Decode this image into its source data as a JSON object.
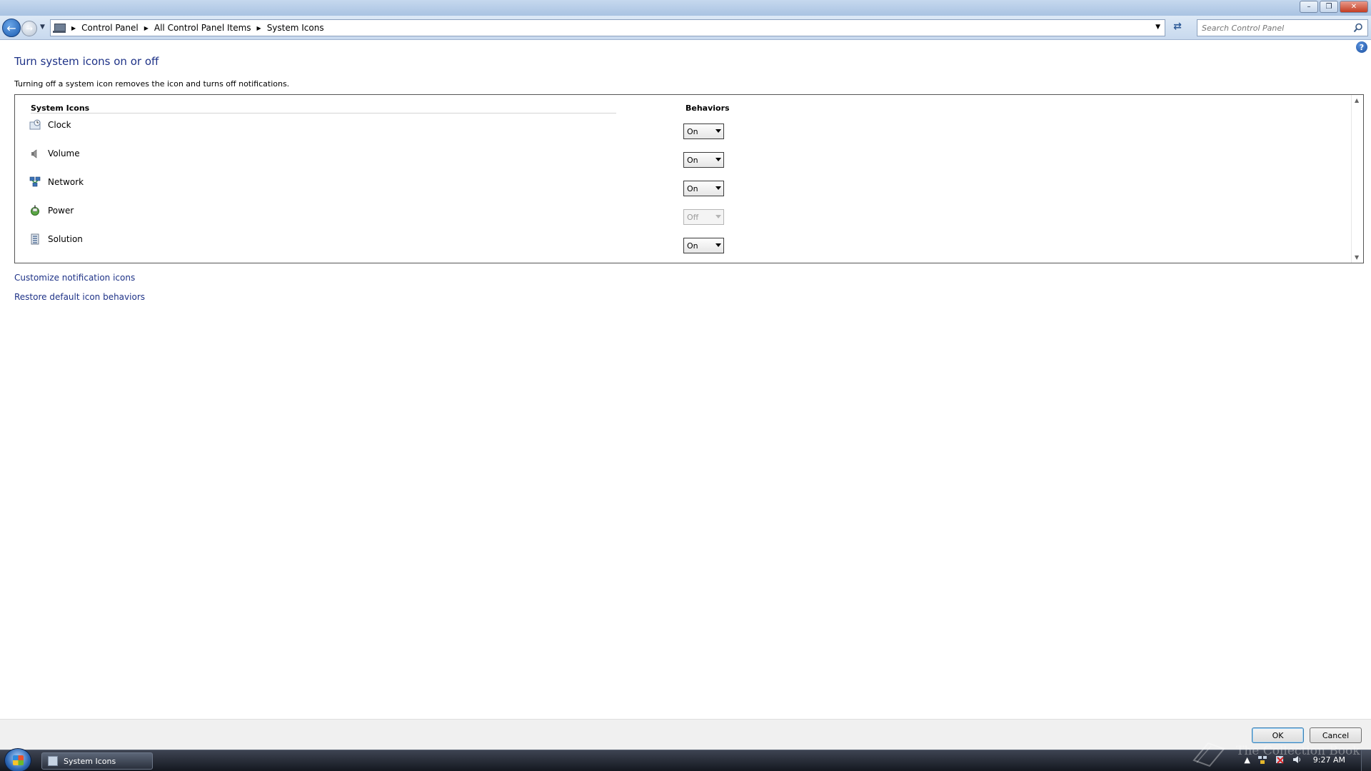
{
  "breadcrumbs": [
    "Control Panel",
    "All Control Panel Items",
    "System Icons"
  ],
  "search": {
    "placeholder": "Search Control Panel"
  },
  "page": {
    "title": "Turn system icons on or off",
    "description": "Turning off a system icon removes the icon and turns off notifications."
  },
  "table": {
    "col_icons": "System Icons",
    "col_behaviors": "Behaviors",
    "rows": [
      {
        "label": "Clock",
        "value": "On",
        "enabled": true,
        "icon": "clock-icon"
      },
      {
        "label": "Volume",
        "value": "On",
        "enabled": true,
        "icon": "volume-icon"
      },
      {
        "label": "Network",
        "value": "On",
        "enabled": true,
        "icon": "network-icon"
      },
      {
        "label": "Power",
        "value": "Off",
        "enabled": false,
        "icon": "power-icon"
      },
      {
        "label": "Solution",
        "value": "On",
        "enabled": true,
        "icon": "action-center-icon"
      }
    ]
  },
  "links": {
    "customize": "Customize notification icons",
    "restore": "Restore default icon behaviors"
  },
  "buttons": {
    "ok": "OK",
    "cancel": "Cancel"
  },
  "taskbar": {
    "task_label": "System Icons",
    "clock": "9:27 AM"
  },
  "watermark": "The Collection Book",
  "colors": {
    "link": "#1e3287",
    "title": "#1e3287"
  }
}
